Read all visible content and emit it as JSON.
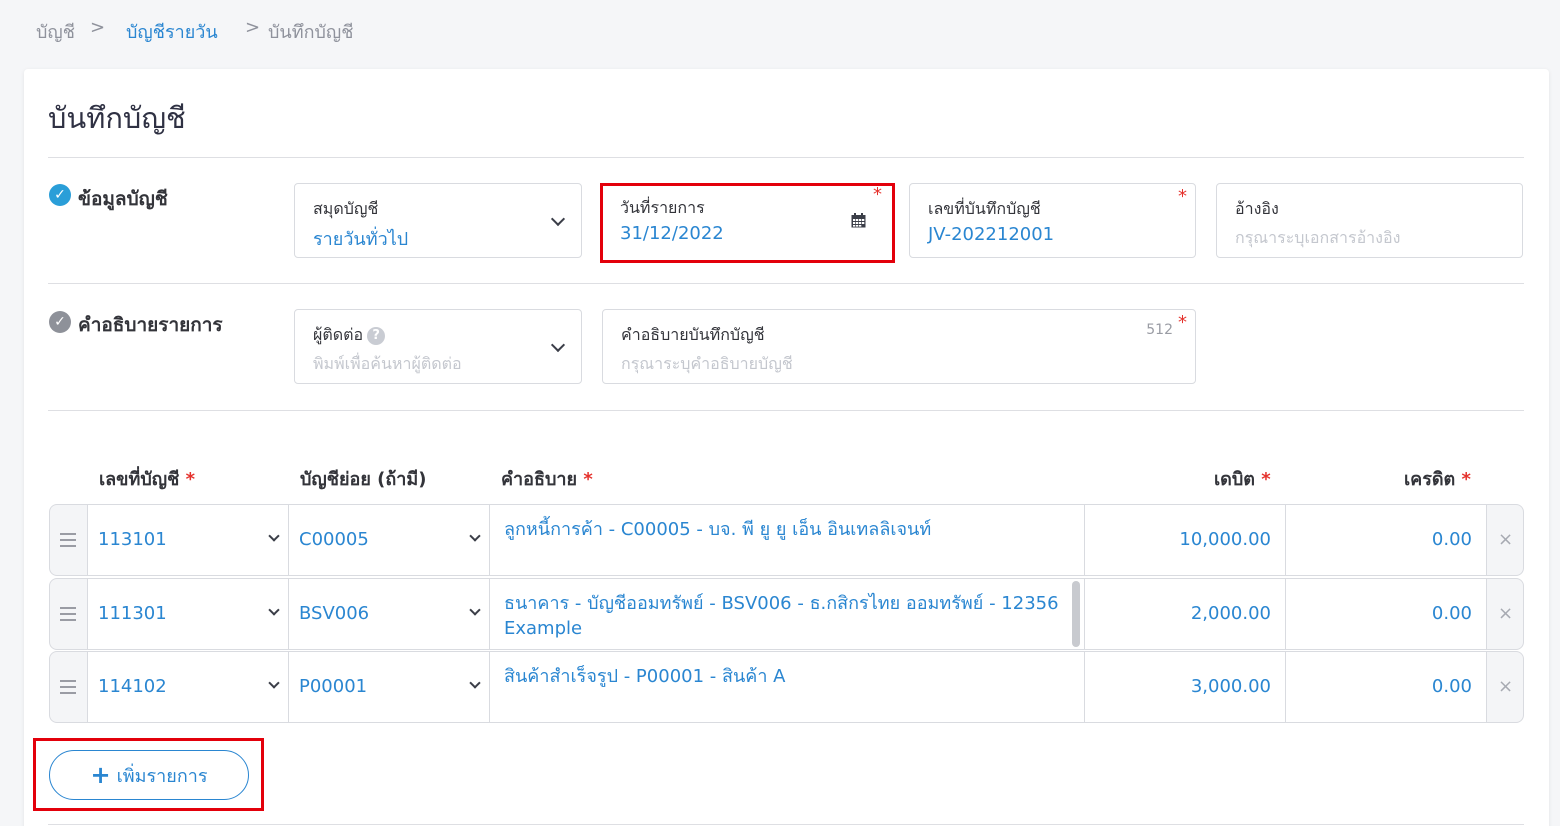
{
  "breadcrumb": {
    "items": [
      "บัญชี",
      "บัญชีรายวัน",
      "บันทึกบัญชี"
    ],
    "separator": ">"
  },
  "page": {
    "title": "บันทึกบัญชี"
  },
  "account_info": {
    "title": "ข้อมูลบัญชี",
    "journal": {
      "label": "สมุดบัญชี",
      "value": "รายวันทั่วไป"
    },
    "date": {
      "label": "วันที่รายการ",
      "value": "31/12/2022",
      "required": "*"
    },
    "doc_no": {
      "label": "เลขที่บันทึกบัญชี",
      "value": "JV-202212001",
      "required": "*"
    },
    "reference": {
      "label": "อ้างอิง",
      "placeholder": "กรุณาระบุเอกสารอ้างอิง"
    }
  },
  "description_section": {
    "title": "คำอธิบายรายการ",
    "contact": {
      "label": "ผู้ติดต่อ",
      "help": "?",
      "placeholder": "พิมพ์เพื่อค้นหาผู้ติดต่อ"
    },
    "memo": {
      "label": "คำอธิบายบันทึกบัญชี",
      "counter": "512",
      "required": "*",
      "placeholder": "กรุณาระบุคำอธิบายบัญชี"
    }
  },
  "table": {
    "headers": {
      "account": "เลขที่บัญชี",
      "sub_account": "บัญชีย่อย (ถ้ามี)",
      "description": "คำอธิบาย",
      "debit": "เดบิต",
      "credit": "เครดิต",
      "required": "*"
    },
    "rows": [
      {
        "account": "113101",
        "sub_account": "C00005",
        "description": "ลูกหนี้การค้า - C00005 - บจ.  พี ยู ยู เอ็น อินเทลลิเจนท์",
        "description2": "",
        "debit": "10,000.00",
        "credit": "0.00"
      },
      {
        "account": "111301",
        "sub_account": "BSV006",
        "description": "ธนาคาร - บัญชีออมทรัพย์ - BSV006 - ธ.กสิกรไทย ออมทรัพย์ - 12356",
        "description2": "Example",
        "debit": "2,000.00",
        "credit": "0.00"
      },
      {
        "account": "114102",
        "sub_account": "P00001",
        "description": "สินค้าสำเร็จรูป - P00001 - สินค้า A",
        "description2": "",
        "debit": "3,000.00",
        "credit": "0.00"
      }
    ],
    "remove_symbol": "×"
  },
  "add_button": {
    "icon": "+",
    "label": "เพิ่มรายการ"
  },
  "colors": {
    "accent": "#2a86d1",
    "highlight": "#e3000b",
    "check_active": "#2a9ed8",
    "check_inactive": "#8e9199"
  }
}
